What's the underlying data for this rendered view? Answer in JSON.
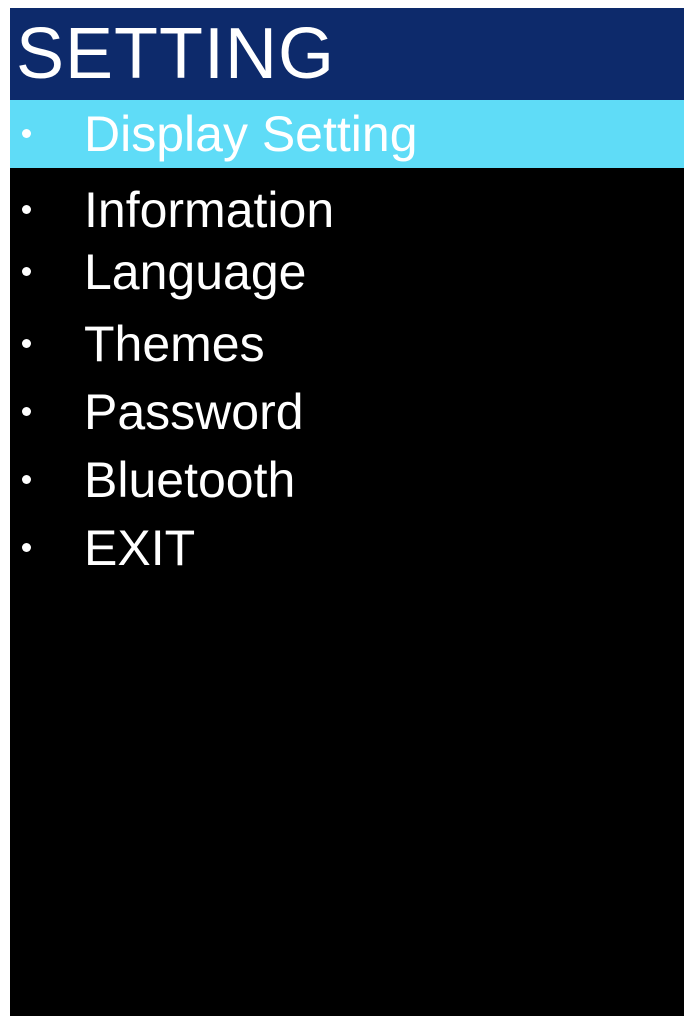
{
  "screen": {
    "title": "SETTING"
  },
  "menu": {
    "items": [
      {
        "label": "Display Setting",
        "selected": true
      },
      {
        "label": "Information",
        "selected": false
      },
      {
        "label": "Language",
        "selected": false
      },
      {
        "label": "Themes",
        "selected": false
      },
      {
        "label": "Password",
        "selected": false
      },
      {
        "label": "Bluetooth",
        "selected": false
      },
      {
        "label": "EXIT",
        "selected": false
      }
    ]
  },
  "colors": {
    "header_bg": "#0d2a6b",
    "selected_bg": "#5fdcf7",
    "screen_bg": "#000000",
    "text": "#ffffff"
  },
  "icons": {
    "bullet": "bullet-dot-icon"
  }
}
